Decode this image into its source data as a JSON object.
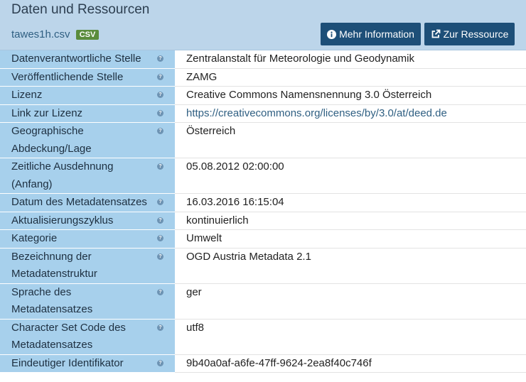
{
  "header": {
    "title": "Daten und Ressourcen",
    "filename": "tawes1h.csv",
    "format_badge": "CSV",
    "btn_info": "Mehr Information",
    "btn_resource": "Zur Ressource",
    "colors": {
      "header_bg": "#bcd5ea",
      "button": "#1d4f78",
      "badge": "#5a8c3c",
      "key_cell": "#a7d0ec"
    }
  },
  "rows": [
    {
      "key": "Datenverantwortliche Stelle",
      "value": "Zentralanstalt für Meteorologie und Geodynamik"
    },
    {
      "key": "Veröffentlichende Stelle",
      "value": "ZAMG"
    },
    {
      "key": "Lizenz",
      "value": "Creative Commons Namensnennung 3.0 Österreich"
    },
    {
      "key": "Link zur Lizenz",
      "value": "https://creativecommons.org/licenses/by/3.0/at/deed.de"
    },
    {
      "key": "Geographische Abdeckung/Lage",
      "value": "Österreich"
    },
    {
      "key": "Zeitliche Ausdehnung (Anfang)",
      "value": "05.08.2012 02:00:00"
    },
    {
      "key": "Datum des Metadatensatzes",
      "value": "16.03.2016 16:15:04"
    },
    {
      "key": "Aktualisierungszyklus",
      "value": "kontinuierlich"
    },
    {
      "key": "Kategorie",
      "value": "Umwelt"
    },
    {
      "key": "Bezeichnung der Metadatenstruktur",
      "value": "OGD Austria Metadata 2.1"
    },
    {
      "key": "Sprache des Metadatensatzes",
      "value": "ger"
    },
    {
      "key": "Character Set Code des Metadatensatzes",
      "value": "utf8"
    },
    {
      "key": "Eindeutiger Identifikator",
      "value": "9b40a0af-a6fe-47ff-9624-2ea8f40c746f"
    }
  ],
  "help_icon": "?"
}
